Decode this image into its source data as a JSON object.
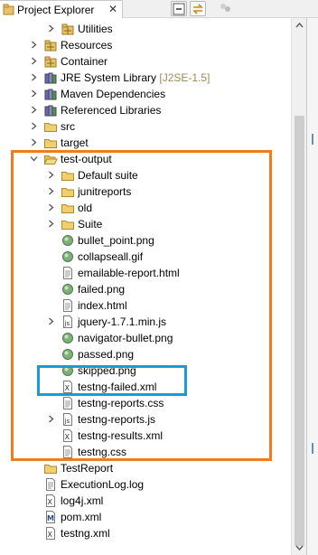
{
  "view": {
    "tab_label": "Project Explorer",
    "close_glyph": "✕",
    "toolbar": [
      {
        "name": "collapse-all-icon"
      },
      {
        "name": "link-with-editor-icon"
      },
      {
        "name": "view-menu-icon"
      }
    ]
  },
  "tree": [
    {
      "label": "Utilities",
      "icon": "package",
      "twisty": "collapsed",
      "depth": 3
    },
    {
      "label": "Resources",
      "icon": "package",
      "twisty": "collapsed",
      "depth": 2
    },
    {
      "label": "Container",
      "icon": "package",
      "twisty": "collapsed",
      "depth": 2
    },
    {
      "label": "JRE System Library",
      "decoration": "[J2SE-1.5]",
      "icon": "library",
      "twisty": "collapsed",
      "depth": 2
    },
    {
      "label": "Maven Dependencies",
      "icon": "library",
      "twisty": "collapsed",
      "depth": 2
    },
    {
      "label": "Referenced Libraries",
      "icon": "library",
      "twisty": "collapsed",
      "depth": 2
    },
    {
      "label": "src",
      "icon": "folder",
      "twisty": "collapsed",
      "depth": 2
    },
    {
      "label": "target",
      "icon": "folder",
      "twisty": "collapsed",
      "depth": 2
    },
    {
      "label": "test-output",
      "icon": "folder-open",
      "twisty": "expanded",
      "depth": 2
    },
    {
      "label": "Default suite",
      "icon": "folder",
      "twisty": "collapsed",
      "depth": 3
    },
    {
      "label": "junitreports",
      "icon": "folder",
      "twisty": "collapsed",
      "depth": 3
    },
    {
      "label": "old",
      "icon": "folder",
      "twisty": "collapsed",
      "depth": 3
    },
    {
      "label": "Suite",
      "icon": "folder",
      "twisty": "collapsed",
      "depth": 3
    },
    {
      "label": "bullet_point.png",
      "icon": "image",
      "twisty": "none",
      "depth": 3
    },
    {
      "label": "collapseall.gif",
      "icon": "image",
      "twisty": "none",
      "depth": 3
    },
    {
      "label": "emailable-report.html",
      "icon": "file",
      "twisty": "none",
      "depth": 3
    },
    {
      "label": "failed.png",
      "icon": "image",
      "twisty": "none",
      "depth": 3
    },
    {
      "label": "index.html",
      "icon": "file",
      "twisty": "none",
      "depth": 3
    },
    {
      "label": "jquery-1.7.1.min.js",
      "icon": "js",
      "twisty": "collapsed",
      "depth": 3
    },
    {
      "label": "navigator-bullet.png",
      "icon": "image",
      "twisty": "none",
      "depth": 3
    },
    {
      "label": "passed.png",
      "icon": "image",
      "twisty": "none",
      "depth": 3
    },
    {
      "label": "skipped.png",
      "icon": "image",
      "twisty": "none",
      "depth": 3
    },
    {
      "label": "testng-failed.xml",
      "icon": "xml",
      "twisty": "none",
      "depth": 3
    },
    {
      "label": "testng-reports.css",
      "icon": "file",
      "twisty": "none",
      "depth": 3
    },
    {
      "label": "testng-reports.js",
      "icon": "js",
      "twisty": "collapsed",
      "depth": 3
    },
    {
      "label": "testng-results.xml",
      "icon": "xml",
      "twisty": "none",
      "depth": 3
    },
    {
      "label": "testng.css",
      "icon": "file",
      "twisty": "none",
      "depth": 3
    },
    {
      "label": "TestReport",
      "icon": "folder",
      "twisty": "none",
      "depth": 2
    },
    {
      "label": "ExecutionLog.log",
      "icon": "file",
      "twisty": "none",
      "depth": 2
    },
    {
      "label": "log4j.xml",
      "icon": "xml",
      "twisty": "none",
      "depth": 2
    },
    {
      "label": "pom.xml",
      "icon": "maven",
      "twisty": "none",
      "depth": 2
    },
    {
      "label": "testng.xml",
      "icon": "xml",
      "twisty": "none",
      "depth": 2
    }
  ],
  "highlights": [
    {
      "name": "test-output-highlight",
      "color": "#f07c1e"
    },
    {
      "name": "testng-failed-highlight",
      "color": "#1a9ad6"
    }
  ]
}
